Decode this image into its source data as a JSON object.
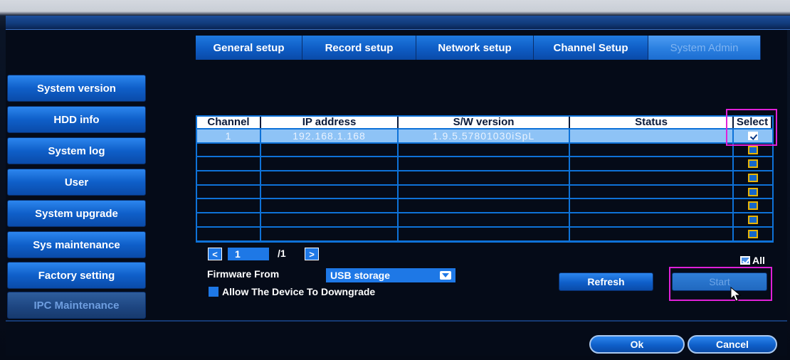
{
  "tabs": [
    {
      "label": "General setup",
      "active": false
    },
    {
      "label": "Record setup",
      "active": false
    },
    {
      "label": "Network setup",
      "active": false
    },
    {
      "label": "Channel Setup",
      "active": false
    },
    {
      "label": "System Admin",
      "active": true
    }
  ],
  "sidebar": {
    "items": [
      {
        "label": "System version"
      },
      {
        "label": "HDD info"
      },
      {
        "label": "System log"
      },
      {
        "label": "User"
      },
      {
        "label": "System upgrade"
      },
      {
        "label": "Sys maintenance"
      },
      {
        "label": "Factory setting"
      },
      {
        "label": "IPC Maintenance",
        "active": true
      }
    ]
  },
  "table": {
    "headers": [
      "Channel",
      "IP address",
      "S/W version",
      "Status",
      "Select"
    ],
    "rows": [
      {
        "channel": "1",
        "ip": "192.168.1.168",
        "version": "1.9.5.57801030iSpL",
        "status": "",
        "selected": true
      },
      {
        "channel": "",
        "ip": "",
        "version": "",
        "status": "",
        "selected": false
      },
      {
        "channel": "",
        "ip": "",
        "version": "",
        "status": "",
        "selected": false
      },
      {
        "channel": "",
        "ip": "",
        "version": "",
        "status": "",
        "selected": false
      },
      {
        "channel": "",
        "ip": "",
        "version": "",
        "status": "",
        "selected": false
      },
      {
        "channel": "",
        "ip": "",
        "version": "",
        "status": "",
        "selected": false
      },
      {
        "channel": "",
        "ip": "",
        "version": "",
        "status": "",
        "selected": false
      },
      {
        "channel": "",
        "ip": "",
        "version": "",
        "status": "",
        "selected": false
      }
    ]
  },
  "pager": {
    "prev": "<",
    "next": ">",
    "current": "1",
    "total": "/1"
  },
  "select_all": {
    "label": "All",
    "checked": true
  },
  "firmware": {
    "label": "Firmware From",
    "value": "USB storage"
  },
  "downgrade": {
    "label": "Allow The Device To Downgrade"
  },
  "buttons": {
    "refresh": "Refresh",
    "start": "Start",
    "ok": "Ok",
    "cancel": "Cancel"
  },
  "colors": {
    "accent": "#1e78e6",
    "highlight": "#e020d8",
    "checkbox_border": "#e8b400"
  }
}
